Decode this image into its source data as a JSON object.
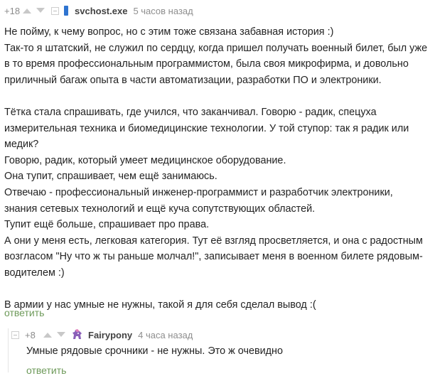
{
  "comment": {
    "rating": "+18",
    "author": "svchost.exe",
    "time": "5 часов назад",
    "lines": [
      "Не пойму, к чему вопрос, но с этим тоже связана забавная история :)",
      "Так-то я штатский, не служил по сердцу, когда пришел получать военный билет, был уже",
      "в то время профессиональным программистом, была своя микрофирма, и довольно",
      "приличный багаж опыта в части автоматизации, разработки ПО и электроники.",
      "",
      "Тётка стала спрашивать, где учился, что заканчивал. Говорю - радик, спецуха",
      "измерительная техника и биомедицинские технологии. У той ступор: так я радик или",
      "медик?",
      "Говорю, радик, который умеет медицинское оборудование.",
      "Она тупит, спрашивает, чем ещё занимаюсь.",
      "Отвечаю - профессиональный инженер-программист и разработчик электроники,",
      "знания сетевых технологий и ещё куча сопутствующих областей.",
      "Тупит ещё больше,  спрашивает про права.",
      "А они у меня есть, легковая категория. Тут её взгляд просветляется, и она с радостным",
      "возгласом \"Ну что ж ты раньше молчал!\", записывает меня в военном билете рядовым-",
      "водителем :)",
      "",
      "В армии у нас умные не нужны, такой я для себя сделал вывод :("
    ],
    "reply_label": "ответить"
  },
  "child": {
    "rating": "+8",
    "author": "Fairypony",
    "time": "4 часа назад",
    "text": "Умные рядовые срочники - не нужны. Это ж очевидно",
    "reply_label": "ответить"
  },
  "icons": {
    "upvote": "triangle-up-icon",
    "downvote": "triangle-down-icon",
    "hide": "minus-box-icon",
    "pony": "pony-avatar-icon"
  },
  "colors": {
    "reply_link": "#6e9a5a",
    "muted": "#8e8e8e",
    "vote_icon": "#c8c8c8",
    "avatar_accent": "#2f74d0"
  }
}
